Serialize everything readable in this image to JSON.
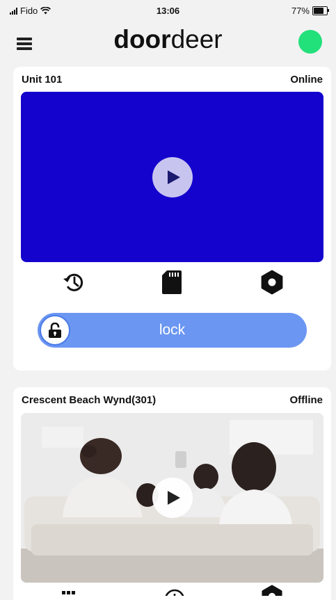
{
  "status_bar": {
    "carrier": "Fido",
    "time": "13:06",
    "battery": "77%",
    "battery_level": 0.77
  },
  "header": {
    "logo_bold": "door",
    "logo_regular": "deer",
    "connection_color": "#22e07a"
  },
  "units": [
    {
      "name": "Unit 101",
      "status": "Online",
      "video_color": "#1402cd",
      "actions": [
        "history-icon",
        "sd-card-icon",
        "settings-icon"
      ],
      "lock_label": "lock"
    },
    {
      "name": "Crescent Beach Wynd(301)",
      "status": "Offline",
      "actions": [
        "grid-icon",
        "clock-icon",
        "settings-icon"
      ]
    }
  ],
  "colors": {
    "accent": "#6b96f2",
    "background": "#f2f2f3"
  }
}
